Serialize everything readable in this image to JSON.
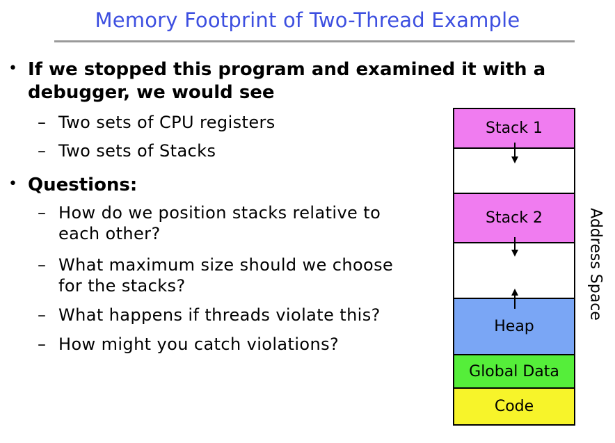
{
  "slide": {
    "title": "Memory Footprint of Two-Thread Example",
    "bullets": [
      {
        "line1": "If we stopped this program and examined it with a",
        "line2": "debugger, we would see",
        "subs": [
          "Two sets of CPU registers",
          "Two sets of Stacks"
        ]
      },
      {
        "line1": "Questions:",
        "subs": [
          {
            "line1": "How do we position stacks relative to",
            "line2": "each other?"
          },
          {
            "line1": "What maximum size should we choose",
            "line2": "for the stacks?"
          },
          {
            "line1": "What happens if threads violate this?"
          },
          {
            "line1": "How might you catch violations?"
          }
        ]
      }
    ]
  },
  "diagram": {
    "segments": [
      {
        "label": "Stack 1",
        "color": "#f07cf0"
      },
      {
        "label": "",
        "color": "#ffffff"
      },
      {
        "label": "Stack 2",
        "color": "#f07cf0"
      },
      {
        "label": "",
        "color": "#ffffff"
      },
      {
        "label": "Heap",
        "color": "#7aa6f5"
      },
      {
        "label": "Global Data",
        "color": "#55ee3a"
      },
      {
        "label": "Code",
        "color": "#f7f42a"
      }
    ],
    "address_label": "Address Space"
  }
}
